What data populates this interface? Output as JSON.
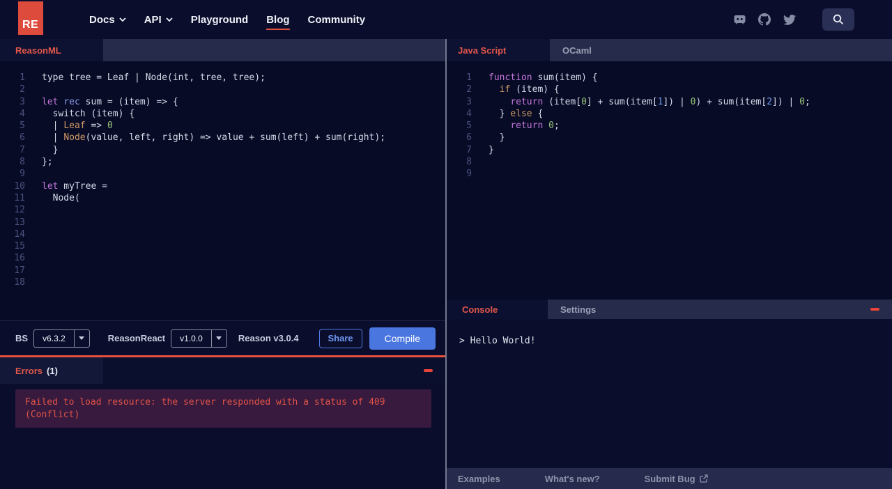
{
  "nav": {
    "logo_text": "RE",
    "items": [
      {
        "label": "Docs",
        "has_chevron": true
      },
      {
        "label": "API",
        "has_chevron": true
      },
      {
        "label": "Playground",
        "has_chevron": false
      },
      {
        "label": "Blog",
        "has_chevron": false,
        "active": true
      },
      {
        "label": "Community",
        "has_chevron": false
      }
    ],
    "social_icons": [
      "discord-icon",
      "github-icon",
      "twitter-icon"
    ],
    "search_icon": "search-icon"
  },
  "editors": {
    "left": {
      "tab": "ReasonML",
      "lines": [
        {
          "n": 1,
          "t": [
            [
              "p",
              "type tree = Leaf | Node(int, tree, tree);"
            ]
          ]
        },
        {
          "n": 2,
          "t": []
        },
        {
          "n": 3,
          "t": [
            [
              "k",
              "let"
            ],
            [
              "p",
              " "
            ],
            [
              "k2",
              "rec"
            ],
            [
              "p",
              " sum = (item) => {"
            ]
          ]
        },
        {
          "n": 4,
          "t": [
            [
              "p",
              "  switch (item) {"
            ]
          ]
        },
        {
          "n": 5,
          "t": [
            [
              "p",
              "  | "
            ],
            [
              "v",
              "Leaf"
            ],
            [
              "p",
              " => "
            ],
            [
              "n",
              "0"
            ]
          ]
        },
        {
          "n": 6,
          "t": [
            [
              "p",
              "  | "
            ],
            [
              "v",
              "Node"
            ],
            [
              "p",
              "(value, left, right) => value + sum(left) + sum(right);"
            ]
          ]
        },
        {
          "n": 7,
          "t": [
            [
              "p",
              "  }"
            ]
          ]
        },
        {
          "n": 8,
          "t": [
            [
              "p",
              "};"
            ]
          ]
        },
        {
          "n": 9,
          "t": []
        },
        {
          "n": 10,
          "t": [
            [
              "k",
              "let"
            ],
            [
              "p",
              " myTree ="
            ]
          ]
        },
        {
          "n": 11,
          "t": [
            [
              "p",
              "  Node("
            ]
          ]
        },
        {
          "n": 12,
          "t": []
        },
        {
          "n": 13,
          "t": []
        },
        {
          "n": 14,
          "t": []
        },
        {
          "n": 15,
          "t": []
        },
        {
          "n": 16,
          "t": []
        },
        {
          "n": 17,
          "t": []
        },
        {
          "n": 18,
          "t": []
        }
      ]
    },
    "right": {
      "tabs": {
        "active": "Java Script",
        "inactive": "OCaml"
      },
      "lines": [
        {
          "n": 1,
          "t": [
            [
              "k",
              "function"
            ],
            [
              "p",
              " sum(item) {"
            ]
          ]
        },
        {
          "n": 2,
          "t": [
            [
              "p",
              "  "
            ],
            [
              "v",
              "if"
            ],
            [
              "p",
              " (item) {"
            ]
          ]
        },
        {
          "n": 3,
          "t": [
            [
              "p",
              "    "
            ],
            [
              "k",
              "return"
            ],
            [
              "p",
              " (item["
            ],
            [
              "n",
              "0"
            ],
            [
              "p",
              "] + sum(item["
            ],
            [
              "n2",
              "1"
            ],
            [
              "p",
              "]) | "
            ],
            [
              "n",
              "0"
            ],
            [
              "p",
              ") + sum(item["
            ],
            [
              "n2",
              "2"
            ],
            [
              "p",
              "]) | "
            ],
            [
              "n",
              "0"
            ],
            [
              "p",
              ";"
            ]
          ]
        },
        {
          "n": 4,
          "t": [
            [
              "p",
              "  } "
            ],
            [
              "v",
              "else"
            ],
            [
              "p",
              " {"
            ]
          ]
        },
        {
          "n": 5,
          "t": [
            [
              "p",
              "    "
            ],
            [
              "k",
              "return"
            ],
            [
              "p",
              " "
            ],
            [
              "n",
              "0"
            ],
            [
              "p",
              ";"
            ]
          ]
        },
        {
          "n": 6,
          "t": [
            [
              "p",
              "  }"
            ]
          ]
        },
        {
          "n": 7,
          "t": [
            [
              "p",
              "}"
            ]
          ]
        },
        {
          "n": 8,
          "t": []
        },
        {
          "n": 9,
          "t": []
        }
      ]
    }
  },
  "toolbar": {
    "bs_label": "BS",
    "bs_version": "v6.3.2",
    "reason_react_label": "ReasonReact",
    "reason_react_version": "v1.0.0",
    "reason_version": "Reason v3.0.4",
    "share_label": "Share",
    "compile_label": "Compile"
  },
  "errors": {
    "title": "Errors",
    "count": "(1)",
    "message": "Failed to load resource: the server responded with a status of 409 (Conflict)"
  },
  "console": {
    "tab_active": "Console",
    "tab_inactive": "Settings",
    "output": "> Hello World!"
  },
  "footer": {
    "items": [
      "Examples",
      "What's new?",
      "Submit Bug"
    ]
  },
  "colors": {
    "accent_red": "#e2574a",
    "logo_red": "#dd4b3d",
    "primary_blue": "#4a76e0",
    "background_navy": "#0a0e2c",
    "editor_navy": "#070b26",
    "tabbar_navy": "#262b4b",
    "error_box_plum": "#371a3d"
  }
}
